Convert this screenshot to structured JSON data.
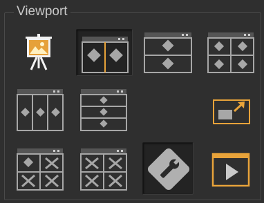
{
  "panel": {
    "title": "Viewport"
  },
  "colors": {
    "background": "#2f2f2f",
    "icon_gray": "#a7a7a7",
    "icon_dark": "#555555",
    "accent_orange": "#e8a33a"
  },
  "buttons": [
    {
      "id": "presentation",
      "icon": "presentation-easel-icon",
      "state": "normal"
    },
    {
      "id": "split-vertical-2",
      "icon": "two-viewport-vertical-icon",
      "state": "active"
    },
    {
      "id": "split-horizontal-2",
      "icon": "two-viewport-horizontal-icon",
      "state": "normal"
    },
    {
      "id": "quad",
      "icon": "four-viewport-icon",
      "state": "normal"
    },
    {
      "id": "split-vertical-3",
      "icon": "three-viewport-vertical-icon",
      "state": "normal"
    },
    {
      "id": "split-horizontal-3",
      "icon": "three-viewport-horizontal-icon",
      "state": "normal"
    },
    {
      "id": "export-viewport",
      "icon": "export-arrow-icon",
      "state": "normal"
    },
    {
      "id": "layout-1-over-3",
      "icon": "layout-mixed-icon",
      "state": "normal"
    },
    {
      "id": "layout-empty-quad",
      "icon": "empty-quad-icon",
      "state": "normal"
    },
    {
      "id": "viewport-settings",
      "icon": "wrench-icon",
      "state": "normal"
    },
    {
      "id": "play-viewport",
      "icon": "play-icon",
      "state": "normal"
    }
  ]
}
